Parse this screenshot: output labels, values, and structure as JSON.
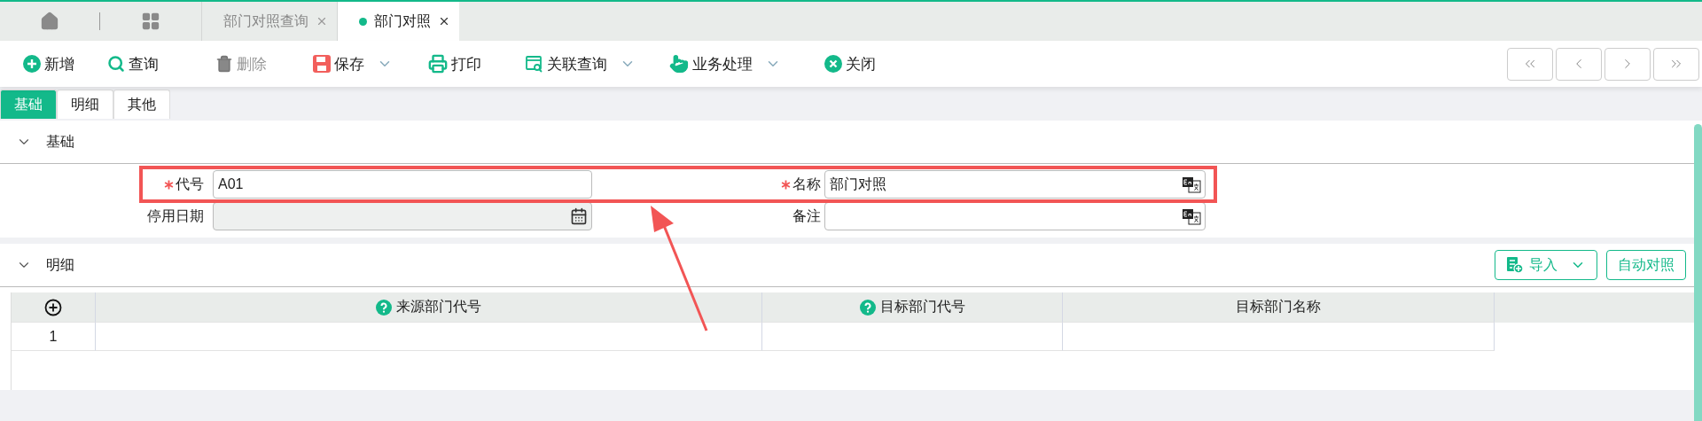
{
  "tabs": [
    {
      "label": "部门对照查询",
      "selected": false
    },
    {
      "label": "部门对照",
      "selected": true
    }
  ],
  "toolbar": {
    "buttons": [
      {
        "label": "新增",
        "kind": "add",
        "disabled": false,
        "dropdown": false
      },
      {
        "label": "查询",
        "kind": "search",
        "disabled": false,
        "dropdown": false
      },
      {
        "label": "删除",
        "kind": "delete",
        "disabled": true,
        "dropdown": false
      },
      {
        "label": "保存",
        "kind": "save",
        "disabled": false,
        "dropdown": true
      },
      {
        "label": "打印",
        "kind": "print",
        "disabled": false,
        "dropdown": false
      },
      {
        "label": "关联查询",
        "kind": "linked",
        "disabled": false,
        "dropdown": true
      },
      {
        "label": "业务处理",
        "kind": "hand",
        "disabled": false,
        "dropdown": true
      },
      {
        "label": "关闭",
        "kind": "close",
        "disabled": false,
        "dropdown": false
      }
    ]
  },
  "subtabs": [
    {
      "label": "基础",
      "selected": true
    },
    {
      "label": "明细",
      "selected": false
    },
    {
      "label": "其他",
      "selected": false
    }
  ],
  "basic_section": {
    "title": "基础",
    "expanded": true,
    "fields": [
      {
        "label": "代号",
        "required": true,
        "value": "A01",
        "kind": "text",
        "disabled": false
      },
      {
        "label": "名称",
        "required": true,
        "value": "部门对照",
        "kind": "translate",
        "disabled": false
      },
      {
        "label": "停用日期",
        "required": false,
        "kind": "date",
        "disabled": true
      },
      {
        "label": "备注",
        "required": false,
        "kind": "translate",
        "disabled": false
      }
    ]
  },
  "detail_section": {
    "title": "明细",
    "expanded": true,
    "actions": [
      {
        "label": "导入",
        "kind": "import",
        "dropdown": true
      },
      {
        "label": "自动对照",
        "kind": "plain",
        "dropdown": false
      }
    ],
    "table": {
      "columns": [
        {
          "label": "来源部门代号",
          "help": true
        },
        {
          "label": "目标部门代号",
          "help": true
        },
        {
          "label": "目标部门名称",
          "help": false
        }
      ],
      "rows": [
        {
          "index": "1"
        }
      ]
    }
  }
}
